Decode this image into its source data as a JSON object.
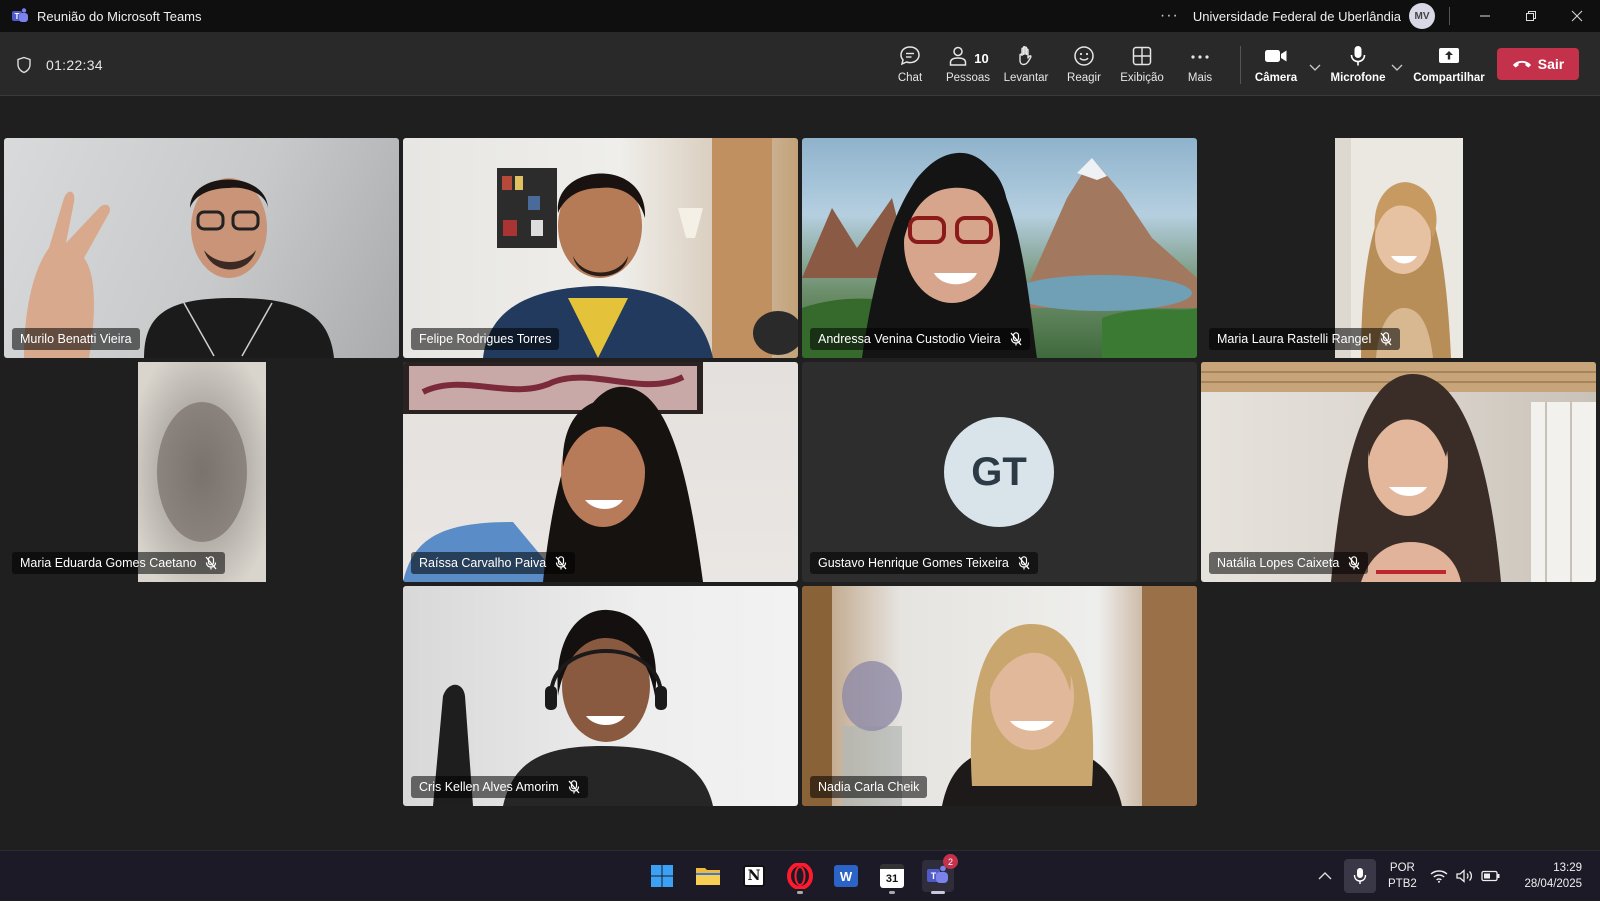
{
  "window": {
    "title": "Reunião do Microsoft Teams",
    "more_label": "···",
    "organization": "Universidade Federal de Uberlândia",
    "user_initials": "MV"
  },
  "meeting": {
    "elapsed_time": "01:22:34",
    "toolbar": {
      "chat": "Chat",
      "people": "Pessoas",
      "people_count": "10",
      "raise_hand": "Levantar",
      "react": "Reagir",
      "view": "Exibição",
      "more": "Mais",
      "camera": "Câmera",
      "microphone": "Microfone",
      "share": "Compartilhar",
      "leave": "Sair"
    }
  },
  "participants": [
    {
      "name": "Murilo Benatti Vieira",
      "muted": false,
      "video": true
    },
    {
      "name": "Felipe Rodrigues Torres",
      "muted": false,
      "video": true
    },
    {
      "name": "Andressa Venina Custodio Vieira",
      "muted": true,
      "video": true
    },
    {
      "name": "Maria Laura Rastelli Rangel",
      "muted": true,
      "video": true
    },
    {
      "name": "Maria Eduarda Gomes Caetano",
      "muted": true,
      "video": true
    },
    {
      "name": "Raíssa Carvalho Paiva",
      "muted": true,
      "video": true
    },
    {
      "name": "Gustavo Henrique Gomes Teixeira",
      "muted": true,
      "video": false,
      "initials": "GT"
    },
    {
      "name": "Natália Lopes Caixeta",
      "muted": true,
      "video": true
    },
    {
      "name": "Cris Kellen Alves Amorim",
      "muted": true,
      "video": true
    },
    {
      "name": "Nadia Carla Cheik",
      "muted": false,
      "video": true
    }
  ],
  "taskbar": {
    "apps": [
      "windows-start",
      "file-explorer",
      "notion",
      "opera",
      "word",
      "calendar",
      "teams"
    ],
    "teams_badge": "2",
    "calendar_day": "31",
    "notion_letter": "N",
    "word_letter": "W",
    "language_line1": "POR",
    "language_line2": "PTB2",
    "time": "13:29",
    "date": "28/04/2025"
  },
  "colors": {
    "leave_button": "#c4314b",
    "stage_background": "#1f1f1f",
    "toolbar_background": "#292929",
    "avatar_gt": "#d9e4ea"
  }
}
